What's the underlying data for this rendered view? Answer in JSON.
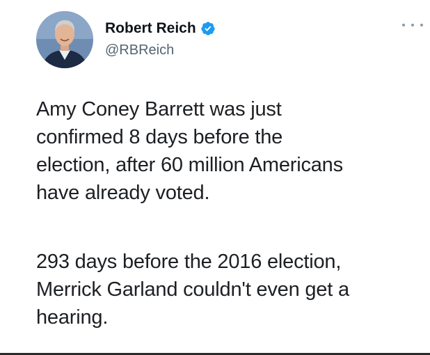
{
  "author": {
    "display_name": "Robert Reich",
    "handle": "@RBReich",
    "verified": true,
    "verified_color": "#1d9bf0"
  },
  "menu": {
    "icon": "more-horizontal-icon"
  },
  "tweet": {
    "paragraphs": [
      {
        "lines": [
          "Amy Coney Barrett was just",
          "confirmed 8 days before the",
          "election, after 60 million Americans",
          "have already voted."
        ]
      },
      {
        "lines": [
          "293 days before the 2016 election,",
          "Merrick Garland couldn't even get a",
          "hearing."
        ]
      }
    ]
  }
}
